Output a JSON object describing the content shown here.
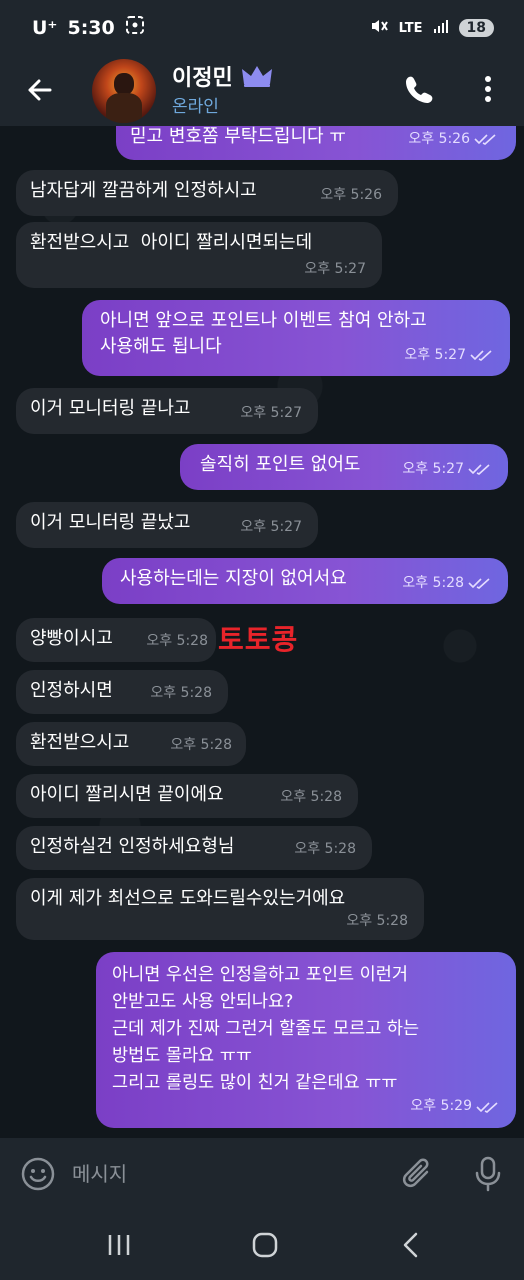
{
  "status_bar": {
    "carrier": "U⁺",
    "time": "5:30",
    "network": "LTE",
    "battery": "18"
  },
  "header": {
    "contact_name": "이정민",
    "contact_status": "온라인"
  },
  "messages": [
    {
      "dir": "out",
      "text": "믿고 변호쫌 부탁드립니다 ㅠ",
      "time": "오후 5:26"
    },
    {
      "dir": "in",
      "text": "남자답게 깔끔하게 인정하시고",
      "time": "오후 5:26"
    },
    {
      "dir": "in",
      "text": "환전받으시고  아이디 짤리시면되는데",
      "time": "오후 5:27"
    },
    {
      "dir": "out",
      "text": "아니면 앞으로 포인트나 이벤트 참여 안하고\n사용해도 됩니다",
      "time": "오후 5:27"
    },
    {
      "dir": "in",
      "text": "이거 모니터링 끝나고",
      "time": "오후 5:27"
    },
    {
      "dir": "out",
      "text": "솔직히 포인트 없어도",
      "time": "오후 5:27"
    },
    {
      "dir": "in",
      "text": "이거 모니터링 끝났고",
      "time": "오후 5:27"
    },
    {
      "dir": "out",
      "text": "사용하는데는 지장이 없어서요",
      "time": "오후 5:28"
    },
    {
      "dir": "in",
      "text": "양빵이시고",
      "time": "오후 5:28"
    },
    {
      "dir": "in",
      "text": "인정하시면",
      "time": "오후 5:28"
    },
    {
      "dir": "in",
      "text": "환전받으시고",
      "time": "오후 5:28"
    },
    {
      "dir": "in",
      "text": "아이디 짤리시면 끝이에요",
      "time": "오후 5:28"
    },
    {
      "dir": "in",
      "text": "인정하실건 인정하세요형님",
      "time": "오후 5:28"
    },
    {
      "dir": "in",
      "text": "이게 제가 최선으로 도와드릴수있는거에요",
      "time": "오후 5:28"
    },
    {
      "dir": "out",
      "text": "아니면 우선은 인정을하고 포인트 이런거\n안받고도 사용 안되나요?\n근데 제가 진짜 그런거 할줄도 모르고 하는\n방법도 몰라요 ㅠㅠ\n그리고 롤링도 많이 친거 같은데요 ㅠㅠ",
      "time": "오후 5:29"
    }
  ],
  "watermark": "토토콩",
  "composer": {
    "placeholder": "메시지"
  },
  "colors": {
    "outgoing": "#7b3fc6",
    "incoming": "#24292f",
    "online": "#6fa8dc",
    "watermark": "#e8242a"
  }
}
